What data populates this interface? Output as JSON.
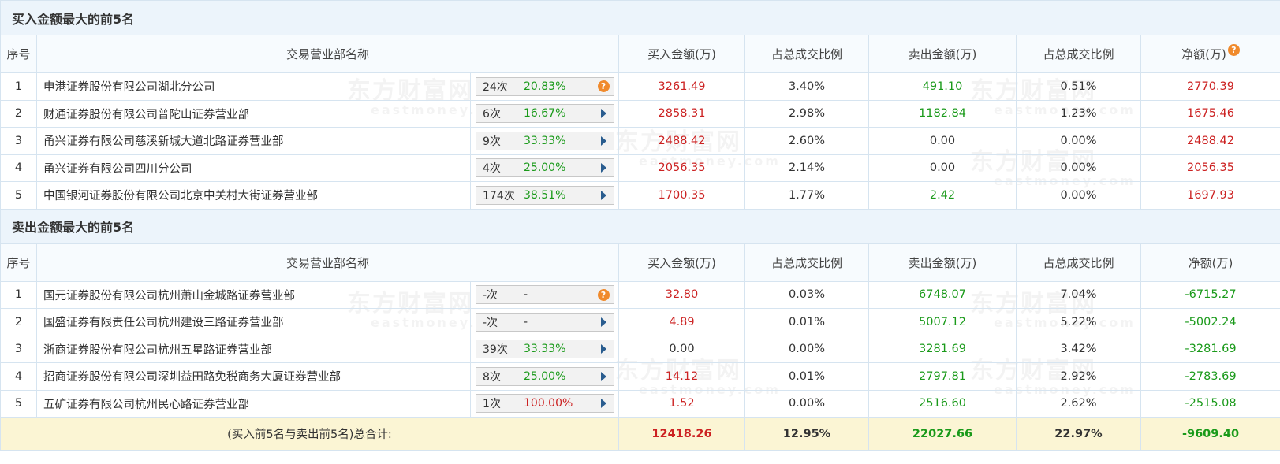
{
  "buy_top": {
    "title": "买入金额最大的前5名",
    "headers": [
      "序号",
      "交易营业部名称",
      "买入金额(万)",
      "占总成交比例",
      "卖出金额(万)",
      "占总成交比例",
      "净额(万)"
    ],
    "rows": [
      {
        "idx": "1",
        "name": "申港证券股份有限公司湖北分公司",
        "count": "24次",
        "pct": "20.83%",
        "buy": "3261.49",
        "buy_ratio": "3.40%",
        "sell": "491.10",
        "sell_ratio": "0.51%",
        "net": "2770.39"
      },
      {
        "idx": "2",
        "name": "财通证券股份有限公司普陀山证券营业部",
        "count": "6次",
        "pct": "16.67%",
        "buy": "2858.31",
        "buy_ratio": "2.98%",
        "sell": "1182.84",
        "sell_ratio": "1.23%",
        "net": "1675.46"
      },
      {
        "idx": "3",
        "name": "甬兴证券有限公司慈溪新城大道北路证券营业部",
        "count": "9次",
        "pct": "33.33%",
        "buy": "2488.42",
        "buy_ratio": "2.60%",
        "sell": "0.00",
        "sell_ratio": "0.00%",
        "net": "2488.42"
      },
      {
        "idx": "4",
        "name": "甬兴证券有限公司四川分公司",
        "count": "4次",
        "pct": "25.00%",
        "buy": "2056.35",
        "buy_ratio": "2.14%",
        "sell": "0.00",
        "sell_ratio": "0.00%",
        "net": "2056.35"
      },
      {
        "idx": "5",
        "name": "中国银河证券股份有限公司北京中关村大街证券营业部",
        "count": "174次",
        "pct": "38.51%",
        "buy": "1700.35",
        "buy_ratio": "1.77%",
        "sell": "2.42",
        "sell_ratio": "0.00%",
        "net": "1697.93"
      }
    ]
  },
  "sell_top": {
    "title": "卖出金额最大的前5名",
    "headers": [
      "序号",
      "交易营业部名称",
      "买入金额(万)",
      "占总成交比例",
      "卖出金额(万)",
      "占总成交比例",
      "净额(万)"
    ],
    "rows": [
      {
        "idx": "1",
        "name": "国元证券股份有限公司杭州萧山金城路证券营业部",
        "count": "-次",
        "pct": "-",
        "buy": "32.80",
        "buy_ratio": "0.03%",
        "sell": "6748.07",
        "sell_ratio": "7.04%",
        "net": "-6715.27"
      },
      {
        "idx": "2",
        "name": "国盛证券有限责任公司杭州建设三路证券营业部",
        "count": "-次",
        "pct": "-",
        "buy": "4.89",
        "buy_ratio": "0.01%",
        "sell": "5007.12",
        "sell_ratio": "5.22%",
        "net": "-5002.24"
      },
      {
        "idx": "3",
        "name": "浙商证券股份有限公司杭州五星路证券营业部",
        "count": "39次",
        "pct": "33.33%",
        "buy": "0.00",
        "buy_ratio": "0.00%",
        "sell": "3281.69",
        "sell_ratio": "3.42%",
        "net": "-3281.69"
      },
      {
        "idx": "4",
        "name": "招商证券股份有限公司深圳益田路免税商务大厦证券营业部",
        "count": "8次",
        "pct": "25.00%",
        "buy": "14.12",
        "buy_ratio": "0.01%",
        "sell": "2797.81",
        "sell_ratio": "2.92%",
        "net": "-2783.69"
      },
      {
        "idx": "5",
        "name": "五矿证券有限公司杭州民心路证券营业部",
        "count": "1次",
        "pct": "100.00%",
        "buy": "1.52",
        "buy_ratio": "0.00%",
        "sell": "2516.60",
        "sell_ratio": "2.62%",
        "net": "-2515.08"
      }
    ]
  },
  "total": {
    "label": "(买入前5名与卖出前5名)总合计:",
    "buy": "12418.26",
    "buy_ratio": "12.95%",
    "sell": "22027.66",
    "sell_ratio": "22.97%",
    "net": "-9609.40"
  },
  "watermark": {
    "cn": "东方财富网",
    "en": "eastmoney.com"
  },
  "colors": {
    "positive": "#cc2222",
    "negative": "#1a9a1a",
    "header_bg": "#ecf4fb",
    "total_bg": "#fbf5d4",
    "help_icon": "#f08a2c"
  }
}
